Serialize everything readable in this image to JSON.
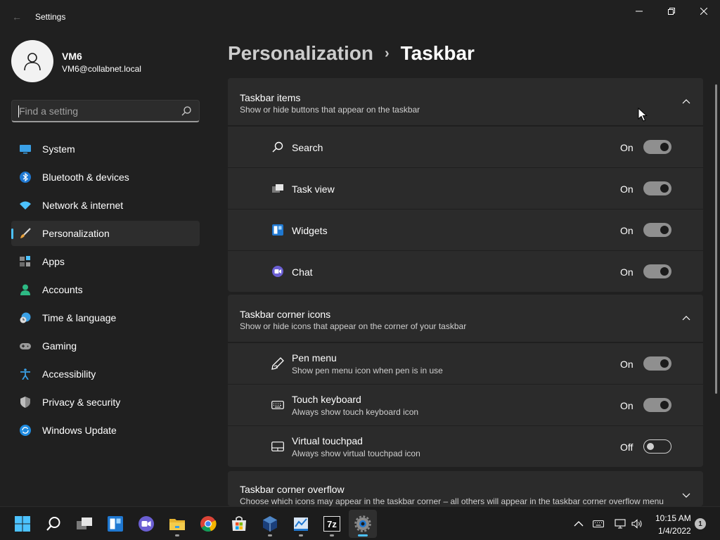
{
  "window": {
    "title": "Settings",
    "back_glyph": "←"
  },
  "profile": {
    "name": "VM6",
    "email": "VM6@collabnet.local"
  },
  "search": {
    "placeholder": "Find a setting"
  },
  "sidebar": {
    "items": [
      {
        "label": "System",
        "icon": "system-icon"
      },
      {
        "label": "Bluetooth & devices",
        "icon": "bluetooth-icon"
      },
      {
        "label": "Network & internet",
        "icon": "wifi-icon"
      },
      {
        "label": "Personalization",
        "icon": "brush-icon",
        "active": true
      },
      {
        "label": "Apps",
        "icon": "apps-icon"
      },
      {
        "label": "Accounts",
        "icon": "accounts-icon"
      },
      {
        "label": "Time & language",
        "icon": "clock-globe-icon"
      },
      {
        "label": "Gaming",
        "icon": "gamepad-icon"
      },
      {
        "label": "Accessibility",
        "icon": "accessibility-icon"
      },
      {
        "label": "Privacy & security",
        "icon": "shield-icon"
      },
      {
        "label": "Windows Update",
        "icon": "update-icon"
      }
    ]
  },
  "breadcrumb": {
    "parent": "Personalization",
    "separator": "›",
    "current": "Taskbar"
  },
  "sections": {
    "taskbar_items": {
      "title": "Taskbar items",
      "subtitle": "Show or hide buttons that appear on the taskbar",
      "rows": [
        {
          "label": "Search",
          "state": "On",
          "on": true,
          "icon": "search-icon"
        },
        {
          "label": "Task view",
          "state": "On",
          "on": true,
          "icon": "task-view-icon"
        },
        {
          "label": "Widgets",
          "state": "On",
          "on": true,
          "icon": "widgets-icon"
        },
        {
          "label": "Chat",
          "state": "On",
          "on": true,
          "icon": "chat-icon"
        }
      ]
    },
    "corner_icons": {
      "title": "Taskbar corner icons",
      "subtitle": "Show or hide icons that appear on the corner of your taskbar",
      "rows": [
        {
          "label": "Pen menu",
          "sub": "Show pen menu icon when pen is in use",
          "state": "On",
          "on": true,
          "icon": "pen-icon"
        },
        {
          "label": "Touch keyboard",
          "sub": "Always show touch keyboard icon",
          "state": "On",
          "on": true,
          "icon": "keyboard-icon"
        },
        {
          "label": "Virtual touchpad",
          "sub": "Always show virtual touchpad icon",
          "state": "Off",
          "on": false,
          "icon": "touchpad-icon"
        }
      ]
    },
    "corner_overflow": {
      "title": "Taskbar corner overflow",
      "subtitle": "Choose which icons may appear in the taskbar corner – all others will appear in the taskbar corner overflow menu"
    }
  },
  "taskbar": {
    "apps": [
      "start-icon",
      "search-icon",
      "task-view-icon",
      "widgets-icon",
      "chat-icon",
      "file-explorer-icon",
      "chrome-icon",
      "store-icon",
      "virtualbox-icon",
      "network-tool-icon",
      "7zip-icon",
      "settings-icon"
    ],
    "seven_zip_label": "7z",
    "time": "10:15 AM",
    "date": "1/4/2022",
    "notification_count": "1"
  },
  "colors": {
    "accent": "#4cc2ff",
    "background": "#202020",
    "card": "#2b2b2b",
    "toggle_on": "#8f8f8f"
  }
}
